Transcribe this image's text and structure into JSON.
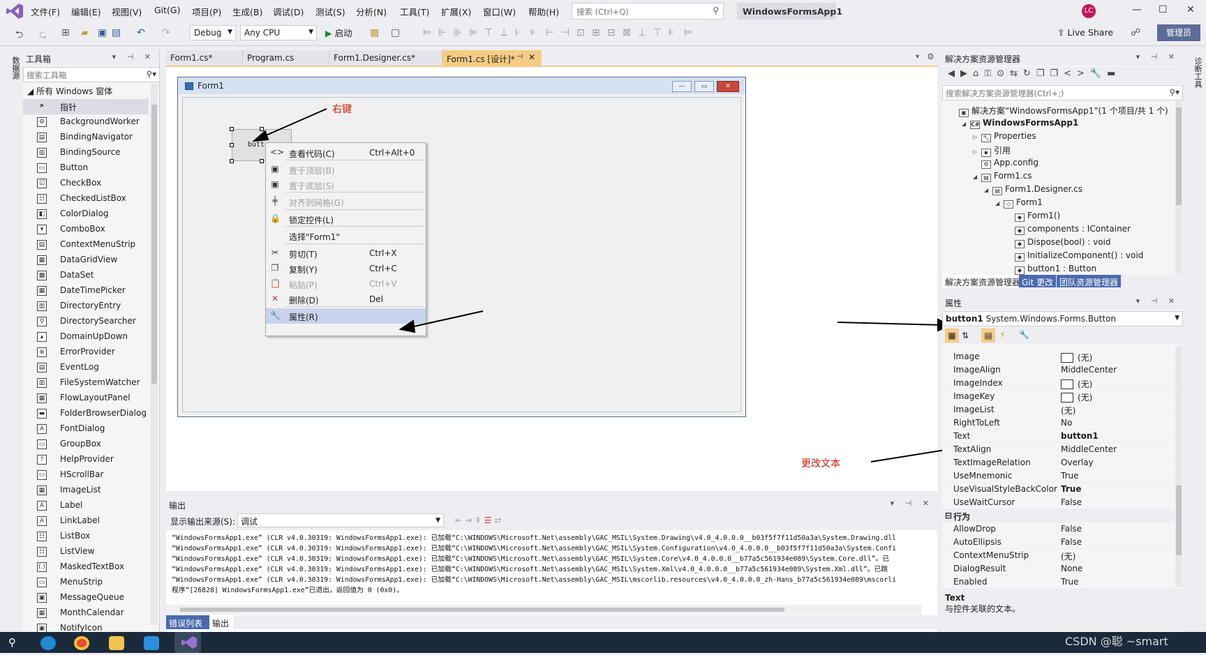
{
  "menubar": {
    "items": [
      "文件(F)",
      "编辑(E)",
      "视图(V)",
      "Git(G)",
      "项目(P)",
      "生成(B)",
      "调试(D)",
      "测试(S)",
      "分析(N)",
      "工具(T)",
      "扩展(X)",
      "窗口(W)",
      "帮助(H)"
    ],
    "search_placeholder": "搜索 (Ctrl+Q)",
    "solution_name": "WindowsFormsApp1",
    "avatar_initials": "LC",
    "min": "—",
    "max": "☐",
    "close": "✕"
  },
  "toolbar": {
    "config": "Debug",
    "platform": "Any CPU",
    "start_label": "启动",
    "live_share": "Live Share",
    "admin": "管理员"
  },
  "side_tabs": {
    "left": "数据源",
    "right": "诊断工具"
  },
  "toolbox": {
    "title": "工具箱",
    "search_placeholder": "搜索工具箱",
    "group": "所有 Windows 窗体",
    "items": [
      "指针",
      "BackgroundWorker",
      "BindingNavigator",
      "BindingSource",
      "Button",
      "CheckBox",
      "CheckedListBox",
      "ColorDialog",
      "ComboBox",
      "ContextMenuStrip",
      "DataGridView",
      "DataSet",
      "DateTimePicker",
      "DirectoryEntry",
      "DirectorySearcher",
      "DomainUpDown",
      "ErrorProvider",
      "EventLog",
      "FileSystemWatcher",
      "FlowLayoutPanel",
      "FolderBrowserDialog",
      "FontDialog",
      "GroupBox",
      "HelpProvider",
      "HScrollBar",
      "ImageList",
      "Label",
      "LinkLabel",
      "ListBox",
      "ListView",
      "MaskedTextBox",
      "MenuStrip",
      "MessageQueue",
      "MonthCalendar",
      "NotifyIcon"
    ]
  },
  "doc_tabs": [
    "Form1.cs*",
    "Program.cs",
    "Form1.Designer.cs*",
    "Form1.cs [设计]*"
  ],
  "form": {
    "title": "Form1",
    "button_text": "butt",
    "min": "—",
    "max": "▭",
    "close": "✕"
  },
  "context_menu": {
    "items": [
      {
        "icon": "<>",
        "label": "查看代码(C)",
        "shortcut": "Ctrl+Alt+0",
        "disabled": false
      },
      {
        "icon": "▣",
        "label": "置于顶层(B)",
        "shortcut": "",
        "disabled": true
      },
      {
        "icon": "▣",
        "label": "置于底层(S)",
        "shortcut": "",
        "disabled": true
      },
      {
        "icon": "╪",
        "label": "对齐到网格(G)",
        "shortcut": "",
        "disabled": true
      },
      {
        "icon": "🔒",
        "label": "锁定控件(L)",
        "shortcut": "",
        "disabled": false
      },
      {
        "icon": "",
        "label": "选择\"Form1\"",
        "shortcut": "",
        "disabled": false
      },
      {
        "icon": "✂",
        "label": "剪切(T)",
        "shortcut": "Ctrl+X",
        "disabled": false
      },
      {
        "icon": "❐",
        "label": "复制(Y)",
        "shortcut": "Ctrl+C",
        "disabled": false
      },
      {
        "icon": "📋",
        "label": "粘贴(P)",
        "shortcut": "Ctrl+V",
        "disabled": true
      },
      {
        "icon": "✕",
        "label": "删除(D)",
        "shortcut": "Del",
        "disabled": false
      },
      {
        "icon": "🔧",
        "label": "属性(R)",
        "shortcut": "",
        "disabled": false
      }
    ]
  },
  "annotations": {
    "right_click": "右键",
    "change_text": "更改文本"
  },
  "output": {
    "title": "输出",
    "source_label": "显示输出来源(S):",
    "source_value": "调试",
    "lines": [
      "“WindowsFormsApp1.exe” (CLR v4.0.30319: WindowsFormsApp1.exe): 已加载“C:\\WINDOWS\\Microsoft.Net\\assembly\\GAC_MSIL\\System.Drawing\\v4.0_4.0.0.0__b03f5f7f11d50a3a\\System.Drawing.dll",
      "“WindowsFormsApp1.exe” (CLR v4.0.30319: WindowsFormsApp1.exe): 已加载“C:\\WINDOWS\\Microsoft.Net\\assembly\\GAC_MSIL\\System.Configuration\\v4.0_4.0.0.0__b03f5f7f11d50a3a\\System.Confi",
      "“WindowsFormsApp1.exe” (CLR v4.0.30319: WindowsFormsApp1.exe): 已加载“C:\\WINDOWS\\Microsoft.Net\\assembly\\GAC_MSIL\\System.Core\\v4.0_4.0.0.0__b77a5c561934e089\\System.Core.dll”。已",
      "“WindowsFormsApp1.exe” (CLR v4.0.30319: WindowsFormsApp1.exe): 已加载“C:\\WINDOWS\\Microsoft.Net\\assembly\\GAC_MSIL\\System.Xml\\v4.0_4.0.0.0__b77a5c561934e089\\System.Xml.dll”。已跳",
      "“WindowsFormsApp1.exe” (CLR v4.0.30319: WindowsFormsApp1.exe): 已加载“C:\\WINDOWS\\Microsoft.Net\\assembly\\GAC_MSIL\\mscorlib.resources\\v4.0_4.0.0.0_zh-Hans_b77a5c561934e089\\mscorli",
      "程序“[26828] WindowsFormsApp1.exe”已退出，返回值为 0 (0x0)。"
    ],
    "tabs": [
      "错误列表",
      "输出"
    ]
  },
  "solution": {
    "title": "解决方案资源管理器",
    "search_placeholder": "搜索解决方案资源管理器(Ctrl+;)",
    "tree": [
      "解决方案“WindowsFormsApp1”(1 个项目/共 1 个)",
      "WindowsFormsApp1",
      "Properties",
      "引用",
      "App.config",
      "Form1.cs",
      "Form1.Designer.cs",
      "Form1",
      "Form1()",
      "components : IContainer",
      "Dispose(bool) : void",
      "InitializeComponent() : void",
      "button1 : Button"
    ],
    "tabs": [
      "解决方案资源管理器",
      "Git 更改",
      "团队资源管理器"
    ]
  },
  "properties": {
    "title": "属性",
    "object_name": "button1",
    "object_type": "System.Windows.Forms.Button",
    "rows": [
      {
        "name": "Image",
        "value": "(无)",
        "swatch": true
      },
      {
        "name": "ImageAlign",
        "value": "MiddleCenter"
      },
      {
        "name": "ImageIndex",
        "value": "(无)",
        "swatch": true
      },
      {
        "name": "ImageKey",
        "value": "(无)",
        "swatch": true
      },
      {
        "name": "ImageList",
        "value": "(无)"
      },
      {
        "name": "RightToLeft",
        "value": "No"
      },
      {
        "name": "Text",
        "value": "button1",
        "bold": true
      },
      {
        "name": "TextAlign",
        "value": "MiddleCenter"
      },
      {
        "name": "TextImageRelation",
        "value": "Overlay"
      },
      {
        "name": "UseMnemonic",
        "value": "True"
      },
      {
        "name": "UseVisualStyleBackColor",
        "value": "True",
        "bold": true
      },
      {
        "name": "UseWaitCursor",
        "value": "False"
      },
      {
        "name": "行为",
        "value": "",
        "category": true
      },
      {
        "name": "AllowDrop",
        "value": "False"
      },
      {
        "name": "AutoEllipsis",
        "value": "False"
      },
      {
        "name": "ContextMenuStrip",
        "value": "(无)"
      },
      {
        "name": "DialogResult",
        "value": "None"
      },
      {
        "name": "Enabled",
        "value": "True"
      }
    ],
    "desc_title": "Text",
    "desc_text": "与控件关联的文本。"
  },
  "watermark": "CSDN @聪    ~smart"
}
